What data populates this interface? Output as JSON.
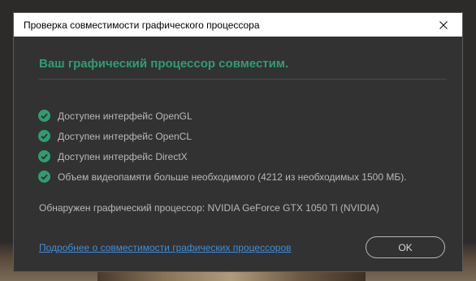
{
  "window": {
    "title": "Проверка совместимости графического процессора",
    "close_icon": "close-icon"
  },
  "main": {
    "heading": "Ваш графический процессор совместим.",
    "check_icon": "check-circle-icon",
    "checks": [
      "Доступен интерфейс OpenGL",
      "Доступен интерфейс OpenCL",
      "Доступен интерфейс DirectX",
      "Объем видеопамяти больше необходимого (4212 из необходимых 1500 МБ)."
    ],
    "gpu_detected": "Обнаружен графический процессор: NVIDIA GeForce GTX 1050 Ti (NVIDIA)"
  },
  "footer": {
    "link_text": "Подробнее о совместимости графических процессоров",
    "ok_label": "OK"
  },
  "colors": {
    "dialog_bg": "#323232",
    "accent_green": "#2e9e72",
    "link_blue": "#3e8edc",
    "text_gray": "#b8b8b8"
  }
}
